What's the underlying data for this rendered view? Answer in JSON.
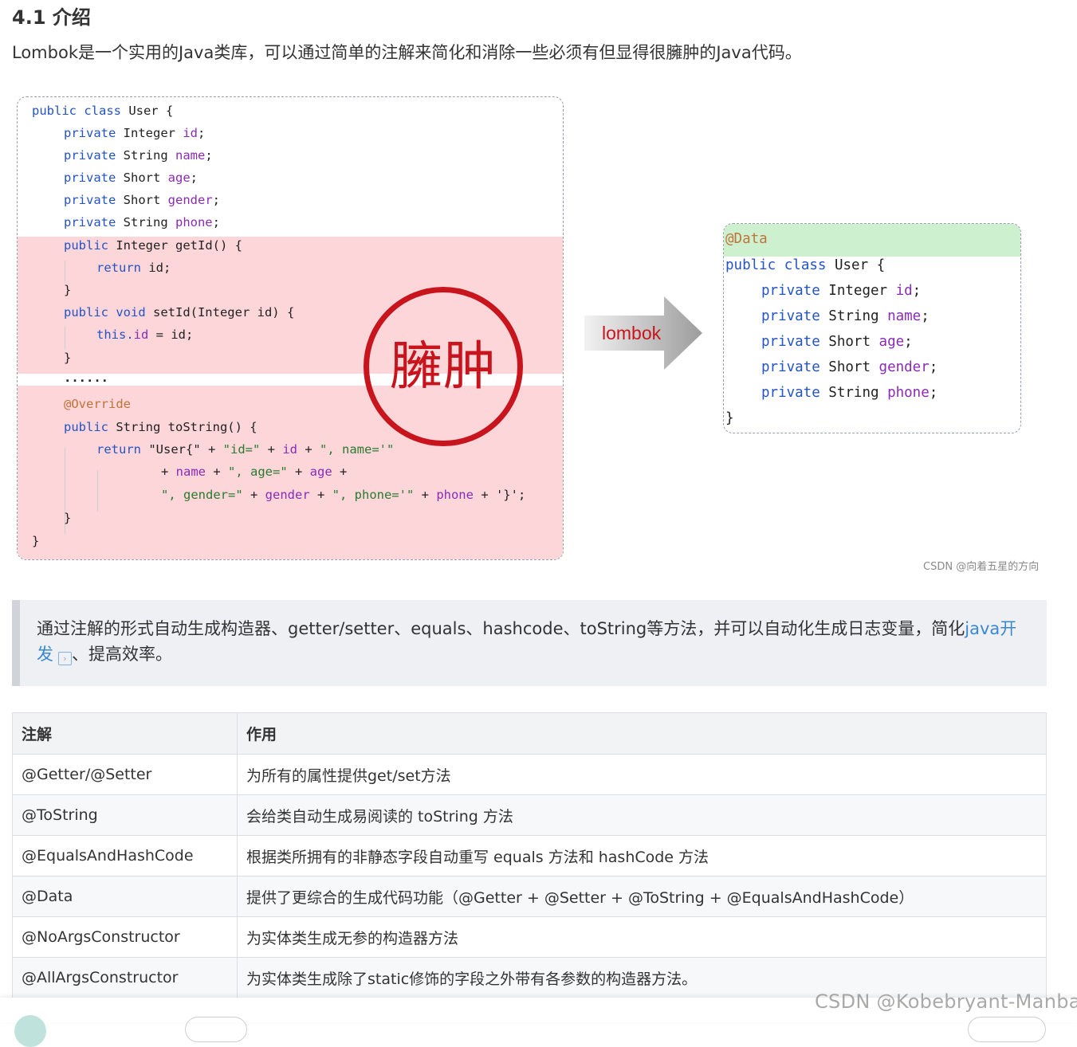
{
  "section": {
    "heading": "4.1 介绍",
    "intro": "Lombok是一个实用的Java类库，可以通过简单的注解来简化和消除一些必须有但显得很臃肿的Java代码。"
  },
  "figure": {
    "left_code": {
      "class_decl_kw": "public class",
      "class_decl_rest": " User {",
      "fields": [
        {
          "kw": "private",
          "type": " Integer ",
          "name": "id",
          "end": ";"
        },
        {
          "kw": "private",
          "type": " String ",
          "name": "name",
          "end": ";"
        },
        {
          "kw": "private",
          "type": " Short ",
          "name": "age",
          "end": ";"
        },
        {
          "kw": "private",
          "type": " Short ",
          "name": "gender",
          "end": ";"
        },
        {
          "kw": "private",
          "type": " String ",
          "name": "phone",
          "end": ";"
        }
      ],
      "getter_kw": "public",
      "getter_rest": " Integer getId() {",
      "getter_return_kw": "return",
      "getter_return_rest": " id;",
      "brace": "}",
      "setter_kw": "public void",
      "setter_rest": " setId(Integer id) {",
      "setter_this": "this.",
      "setter_field": "id",
      "setter_assign": " = id;",
      "ellipsis": "......",
      "override": "@Override",
      "tostring_kw": "public",
      "tostring_rest": " String toString() {",
      "ts_return_kw": "return",
      "ts_line1_a": " \"User{\" + ",
      "ts_line1_b": "\"id=\"",
      "ts_line1_c": " + ",
      "ts_line1_d": "id",
      "ts_line1_e": " + ",
      "ts_line1_f": "\", name='\"",
      "ts_line2_a": "+ ",
      "ts_line2_b": "name",
      "ts_line2_c": " + ",
      "ts_line2_d": "\", age=\"",
      "ts_line2_e": " + ",
      "ts_line2_f": "age",
      "ts_line2_g": " +",
      "ts_line3_a": "\", gender=\"",
      "ts_line3_b": " + ",
      "ts_line3_c": "gender",
      "ts_line3_d": " + ",
      "ts_line3_e": "\", phone='\"",
      "ts_line3_f": " + ",
      "ts_line3_g": "phone",
      "ts_line3_h": " + '}';",
      "closing": "}"
    },
    "stamp_text": "臃肿",
    "arrow_label": "lombok",
    "right_code": {
      "annotation": "@Data",
      "class_decl_kw": "public class",
      "class_decl_rest": " User {",
      "fields": [
        {
          "kw": "private",
          "type": " Integer ",
          "name": "id",
          "end": ";"
        },
        {
          "kw": "private",
          "type": " String ",
          "name": "name",
          "end": ";"
        },
        {
          "kw": "private",
          "type": " Short ",
          "name": "age",
          "end": ";"
        },
        {
          "kw": "private",
          "type": " Short ",
          "name": "gender",
          "end": ";"
        },
        {
          "kw": "private",
          "type": " String ",
          "name": "phone",
          "end": ";"
        }
      ],
      "closing": "}"
    },
    "image_watermark": "CSDN @向着五星的方向"
  },
  "quote": {
    "text_before": "通过注解的形式自动生成构造器、getter/setter、equals、hashcode、toString等方法，并可以自动化生成日志变量，简化",
    "link_text": "java开发",
    "text_after": "、提高效率。"
  },
  "table": {
    "headers": [
      "注解",
      "作用"
    ],
    "rows": [
      [
        "@Getter/@Setter",
        "为所有的属性提供get/set方法"
      ],
      [
        "@ToString",
        "会给类自动生成易阅读的 toString 方法"
      ],
      [
        "@EqualsAndHashCode",
        "根据类所拥有的非静态字段自动重写 equals 方法和 hashCode 方法"
      ],
      [
        "@Data",
        "提供了更综合的生成代码功能（@Getter + @Setter + @ToString + @EqualsAndHashCode）"
      ],
      [
        "@NoArgsConstructor",
        "为实体类生成无参的构造器方法"
      ],
      [
        "@AllArgsConstructor",
        "为实体类生成除了static修饰的字段之外带有各参数的构造器方法。"
      ]
    ]
  },
  "page_watermark": "CSDN @Kobebryant-Manba",
  "colors": {
    "keyword": "#2453c6",
    "field": "#8a2bb8",
    "string": "#2c7a31",
    "annotation": "#c0733a",
    "stamp": "#c8141c",
    "link": "#3a87d6"
  }
}
